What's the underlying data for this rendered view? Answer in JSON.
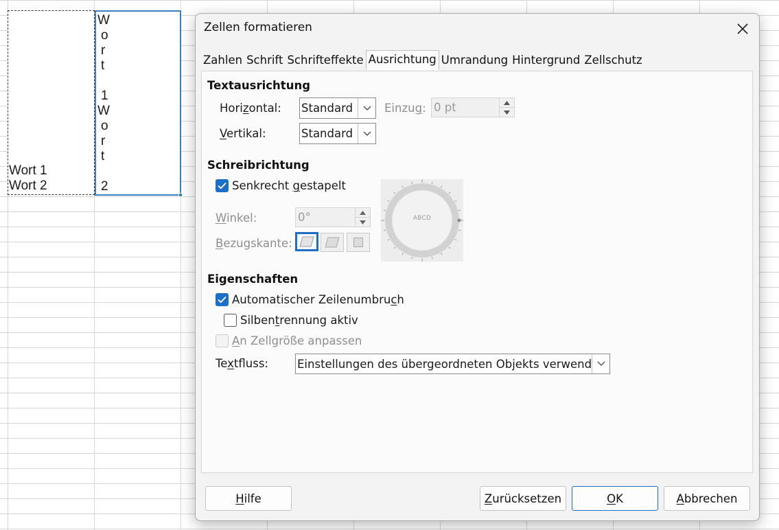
{
  "sheet": {
    "cell_a_lines": [
      "Wort 1",
      "Wort 2"
    ],
    "cell_b_stack": [
      "W",
      "o",
      "r",
      "t",
      "",
      "1",
      "W",
      "o",
      "r",
      "t",
      "",
      "2"
    ]
  },
  "dialog": {
    "title": "Zellen formatieren",
    "close_icon": "close-icon",
    "tabs": [
      "Zahlen",
      "Schrift",
      "Schrifteffekte",
      "Ausrichtung",
      "Umrandung",
      "Hintergrund",
      "Zellschutz"
    ],
    "active_tab": "Ausrichtung"
  },
  "textausrichtung": {
    "heading": "Textausrichtung",
    "horizontal_label": [
      "Hori",
      "z",
      "ontal:"
    ],
    "horizontal_value": "Standard",
    "einzug_label": [
      "Einzu",
      "g",
      ":"
    ],
    "einzug_value": "0 pt",
    "vertikal_label": [
      "",
      "V",
      "ertikal:"
    ],
    "vertikal_value": "Standard"
  },
  "schreibrichtung": {
    "heading": "Schreibrichtung",
    "stacked_label": [
      "Senkrecht ",
      "g",
      "estapelt"
    ],
    "stacked_checked": true,
    "winkel_label": [
      "",
      "W",
      "inkel:"
    ],
    "winkel_value": "0°",
    "bezugskante_label": [
      "",
      "B",
      "ezugskante:"
    ],
    "dial_text": "ABCD"
  },
  "eigenschaften": {
    "heading": "Eigenschaften",
    "autowrap_label": [
      "Automatischer Zeilenumbru",
      "c",
      "h"
    ],
    "autowrap_checked": true,
    "hyphen_label": [
      "Silben",
      "t",
      "rennung aktiv"
    ],
    "hyphen_checked": false,
    "fit_label": [
      "",
      "A",
      "n Zellgröße anpassen"
    ],
    "fit_checked": false,
    "textfluss_label": [
      "Te",
      "x",
      "tfluss:"
    ],
    "textfluss_value": "Einstellungen des übergeordneten Objekts verwenden"
  },
  "buttons": {
    "help": [
      "",
      "H",
      "ilfe"
    ],
    "reset": [
      "",
      "Z",
      "urücksetzen"
    ],
    "ok": [
      "",
      "O",
      "K"
    ],
    "cancel": [
      "",
      "A",
      "bbrechen"
    ]
  },
  "colors": {
    "accent": "#1c6fc7",
    "cell_selection": "#3a7fc1"
  }
}
